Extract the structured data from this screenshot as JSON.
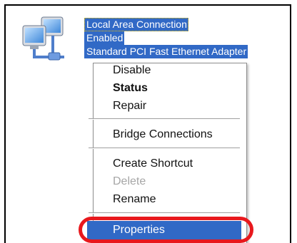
{
  "connection": {
    "icon": "network-connection-icon",
    "name": "Local Area Connection",
    "status": "Enabled",
    "device": "Standard PCI Fast Ethernet Adapter"
  },
  "context_menu": {
    "items": [
      {
        "label": "Disable",
        "state": "normal"
      },
      {
        "label": "Status",
        "state": "default"
      },
      {
        "label": "Repair",
        "state": "normal"
      },
      {
        "label": "Bridge Connections",
        "state": "normal"
      },
      {
        "label": "Create Shortcut",
        "state": "normal"
      },
      {
        "label": "Delete",
        "state": "disabled"
      },
      {
        "label": "Rename",
        "state": "normal"
      },
      {
        "label": "Properties",
        "state": "selected"
      }
    ]
  },
  "colors": {
    "selection": "#3169c6",
    "highlight_ring": "#e8181d",
    "disabled_text": "#a6a6a6"
  }
}
